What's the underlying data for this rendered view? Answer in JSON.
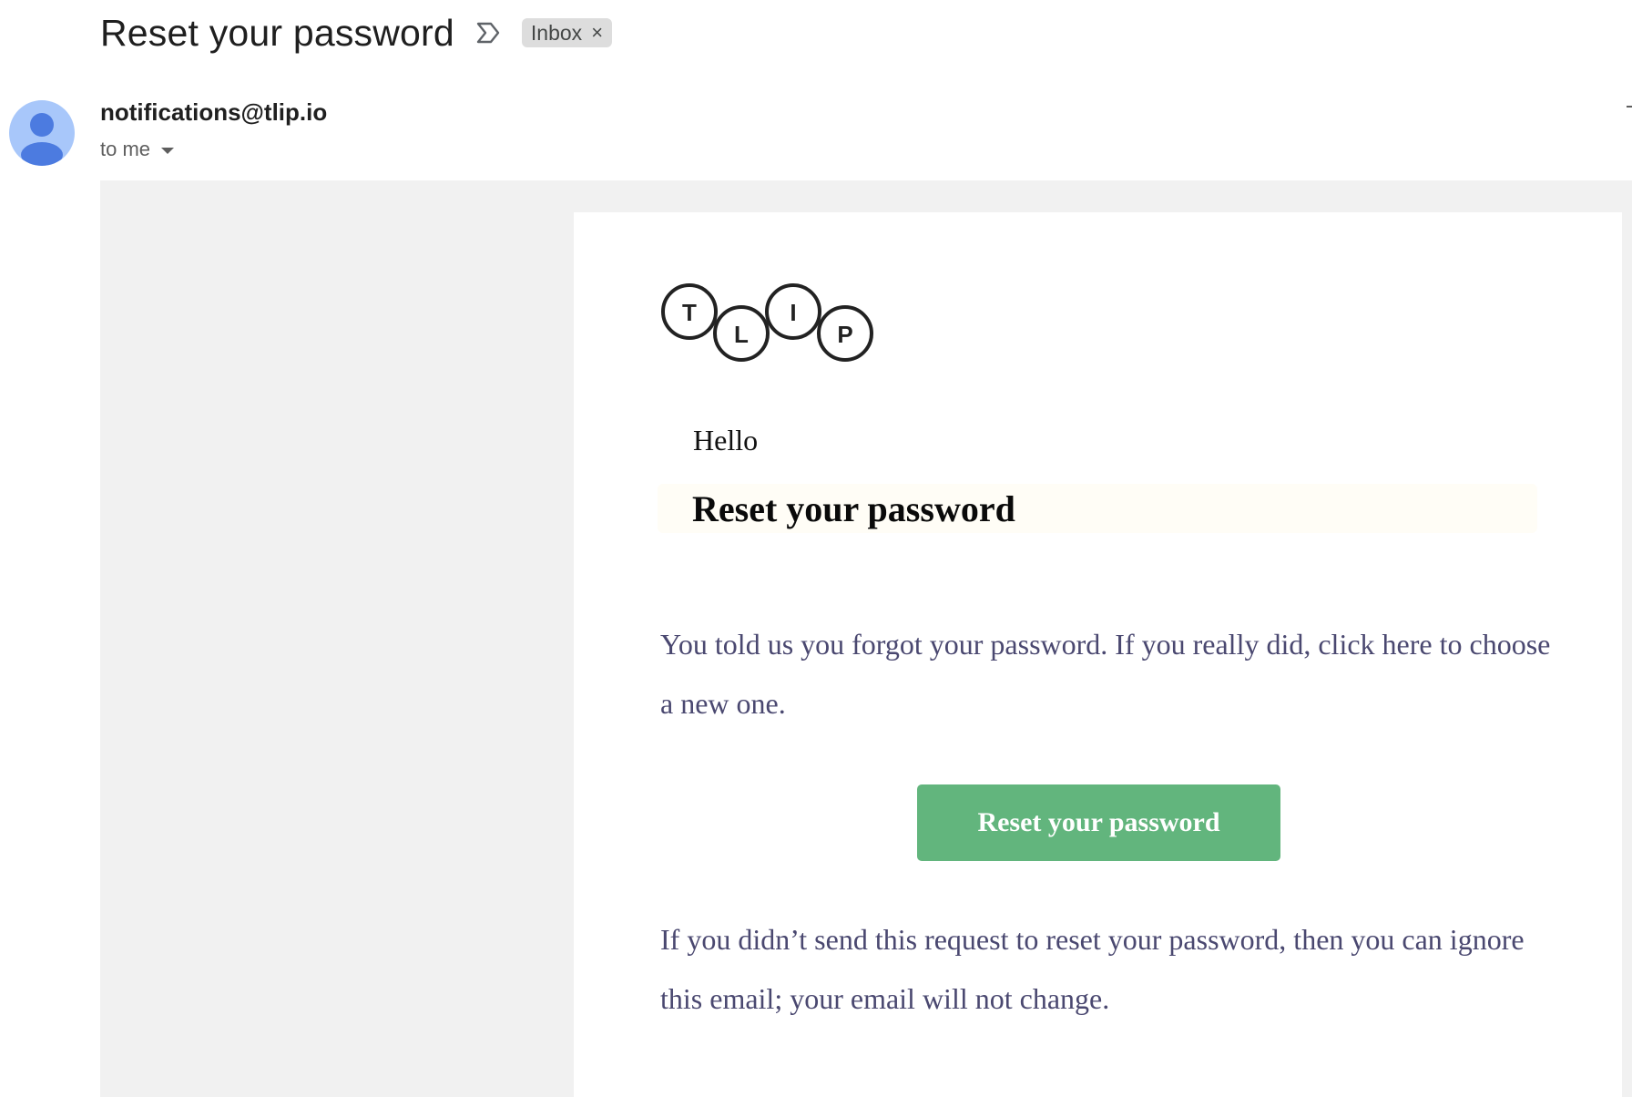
{
  "email": {
    "subject": "Reset your password",
    "label": "Inbox",
    "label_close": "×",
    "sender": "notifications@tlip.io",
    "to": "to me"
  },
  "icons": {
    "important": "important-marker-icon",
    "label_close": "close-icon",
    "avatar": "person-avatar-icon",
    "recipient_dropdown": "caret-down-icon"
  },
  "body": {
    "logo_letters": [
      "T",
      "L",
      "I",
      "P"
    ],
    "greeting": "Hello",
    "heading": "Reset your password",
    "paragraph_1": "You told us you forgot your password. If you really did, click here to choose a new one.",
    "button_label": "Reset your password",
    "paragraph_2": "If you didn’t send this request to reset your password, then you can ignore this email; your email will not change."
  },
  "colors": {
    "button": "#62b57d",
    "body_text": "#4a4870",
    "avatar": "#a8c7fa",
    "avatar_person": "#4c7be0",
    "frame_background": "#f1f1f1",
    "label_chip": "#dddddd"
  }
}
